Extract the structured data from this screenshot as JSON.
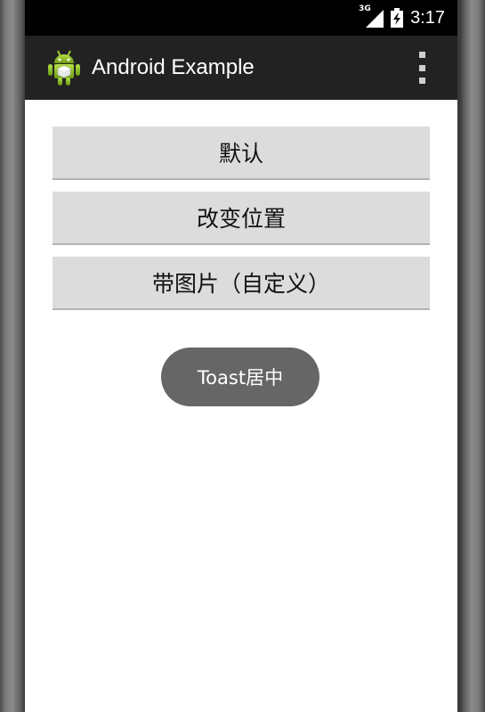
{
  "status_bar": {
    "network_type": "3G",
    "time": "3:17",
    "icons": [
      "signal-icon",
      "battery-icon"
    ]
  },
  "action_bar": {
    "title": "Android Example",
    "icons": [
      "android-app-icon",
      "overflow-menu-icon"
    ]
  },
  "buttons": [
    {
      "label": "默认"
    },
    {
      "label": "改变位置"
    },
    {
      "label": "带图片（自定义）"
    }
  ],
  "toast": {
    "text": "Toast居中"
  },
  "colors": {
    "action_bar_bg": "#222222",
    "status_bar_bg": "#000000",
    "button_bg": "#dcdcdc",
    "toast_bg": "#666666",
    "app_icon_green": "#8fbf1f"
  }
}
